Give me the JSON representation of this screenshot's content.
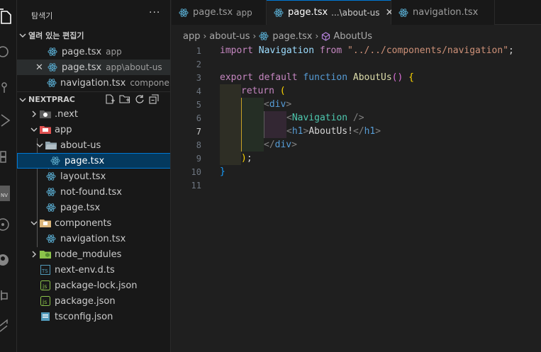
{
  "sidebar": {
    "title": "탐색기",
    "more": "···",
    "open_editors": {
      "header": "열려 있는 편집기",
      "items": [
        {
          "name": "page.tsx",
          "desc": "app"
        },
        {
          "name": "page.tsx",
          "desc": "app\\about-us",
          "close": "✕"
        },
        {
          "name": "navigation.tsx",
          "desc": "components"
        }
      ]
    },
    "project": {
      "header": "NEXTPRAC",
      "items": [
        {
          "name": ".next"
        },
        {
          "name": "app"
        },
        {
          "name": "about-us"
        },
        {
          "name": "page.tsx"
        },
        {
          "name": "layout.tsx"
        },
        {
          "name": "not-found.tsx"
        },
        {
          "name": "page.tsx"
        },
        {
          "name": "components"
        },
        {
          "name": "navigation.tsx"
        },
        {
          "name": "node_modules"
        },
        {
          "name": "next-env.d.ts"
        },
        {
          "name": "package-lock.json"
        },
        {
          "name": "package.json"
        },
        {
          "name": "tsconfig.json"
        }
      ]
    }
  },
  "tabs": [
    {
      "name": "page.tsx",
      "desc": "app"
    },
    {
      "name": "page.tsx",
      "desc": "...\\about-us",
      "close": "✕"
    },
    {
      "name": "navigation.tsx"
    }
  ],
  "breadcrumb": [
    "app",
    "about-us",
    "page.tsx",
    "AboutUs"
  ],
  "editor": {
    "line_numbers": [
      "1",
      "2",
      "3",
      "4",
      "5",
      "6",
      "7",
      "8",
      "9",
      "10",
      "11"
    ],
    "active_line": "7",
    "code": {
      "l1": {
        "import": "import",
        "nav": "Navigation",
        "from": "from",
        "path": "\"../../components/navigation\"",
        "semi": ";"
      },
      "l3": {
        "export": "export",
        "default": "default",
        "function": "function",
        "name": "AboutUs",
        "parens": "()",
        "brace": "{"
      },
      "l4": {
        "return": "return",
        "paren": "("
      },
      "l5": {
        "open": "<",
        "tag": "div",
        "close": ">"
      },
      "l6": {
        "open": "<",
        "comp": "Navigation",
        "close": " />"
      },
      "l7": {
        "open": "<",
        "tag": "h1",
        "mid": ">",
        "text": "AboutUs!",
        "open2": "</",
        "tag2": "h1",
        "close": ">"
      },
      "l8": {
        "open": "</",
        "tag": "div",
        "close": ">"
      },
      "l9": {
        "paren": ")",
        "semi": ";"
      },
      "l10": {
        "brace": "}"
      }
    }
  },
  "colors": {
    "accent": "#0078d4",
    "react_icon": "#519aba",
    "folder_yellow": "#dcb67a",
    "folder_red": "#e05252",
    "json_icon": "#cbcb41",
    "ts_icon": "#519aba"
  }
}
